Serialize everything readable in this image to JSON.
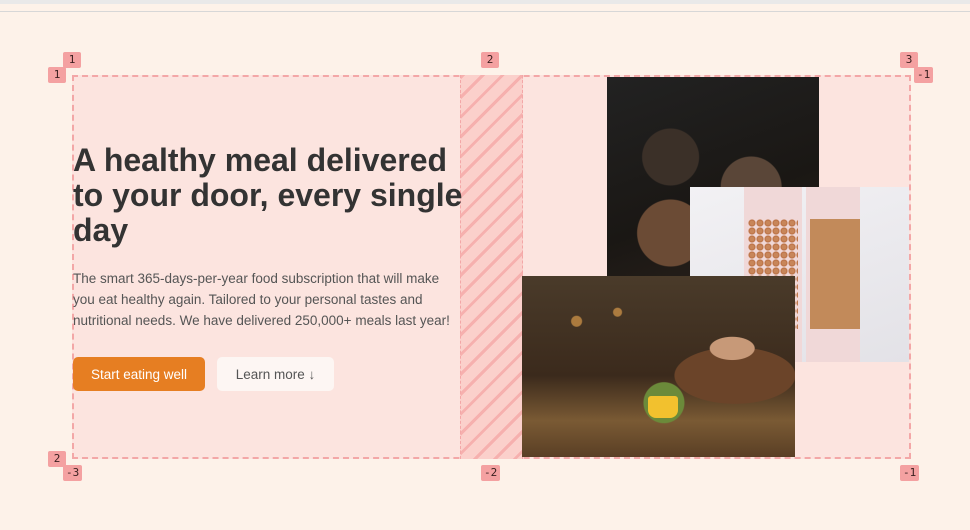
{
  "hero": {
    "title": "A healthy meal delivered to your door, every single day",
    "description": "The smart 365-days-per-year food subscription that will make you eat healthy again. Tailored to your personal tastes and nutritional needs. We have delivered 250,000+ meals last year!",
    "primary_button": "Start eating well",
    "secondary_button": "Learn more ↓"
  },
  "grid_overlay": {
    "markers": {
      "col_top_1": "1",
      "col_top_2": "2",
      "col_top_3": "3",
      "row_left_1": "1",
      "row_left_2": "2",
      "row_right_neg1": "-1",
      "col_bottom_neg3": "-3",
      "col_bottom_neg2": "-2",
      "col_bottom_neg1": "-1"
    }
  },
  "colors": {
    "accent": "#e67e22",
    "background": "#fdf2e9",
    "overlay": "#f3a7a7"
  }
}
